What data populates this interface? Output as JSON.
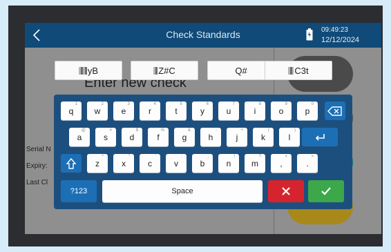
{
  "header": {
    "title": "Check Standards",
    "time": "09:49:23",
    "date": "12/12/2024"
  },
  "page": {
    "heading": "Enter new check",
    "labels": [
      "Serial N",
      "Expiry:",
      "Last Cl"
    ]
  },
  "codes": [
    "yB",
    "Z#C",
    "Q#",
    "C3t"
  ],
  "keyboard": {
    "row1": [
      {
        "k": "q",
        "h": "1"
      },
      {
        "k": "w",
        "h": "2"
      },
      {
        "k": "e",
        "h": "3"
      },
      {
        "k": "r",
        "h": "4"
      },
      {
        "k": "t",
        "h": "5"
      },
      {
        "k": "y",
        "h": "6"
      },
      {
        "k": "u",
        "h": "7"
      },
      {
        "k": "i",
        "h": "8"
      },
      {
        "k": "o",
        "h": "9"
      },
      {
        "k": "p",
        "h": "0"
      }
    ],
    "row2": [
      {
        "k": "a",
        "h": "@"
      },
      {
        "k": "s",
        "h": "#"
      },
      {
        "k": "d",
        "h": "$"
      },
      {
        "k": "f",
        "h": "%"
      },
      {
        "k": "g",
        "h": "&"
      },
      {
        "k": "h",
        "h": "-"
      },
      {
        "k": "j",
        "h": "+"
      },
      {
        "k": "k",
        "h": "("
      },
      {
        "k": "l",
        "h": ")"
      }
    ],
    "row3": [
      {
        "k": "z",
        "h": "*"
      },
      {
        "k": "x",
        "h": "\""
      },
      {
        "k": "c",
        "h": "'"
      },
      {
        "k": "v",
        "h": ":"
      },
      {
        "k": "b",
        "h": ";"
      },
      {
        "k": "n",
        "h": "!"
      },
      {
        "k": "m",
        "h": "?"
      },
      {
        "k": ",",
        "h": "<"
      },
      {
        "k": ".",
        "h": ">"
      }
    ],
    "numbers_label": "?123",
    "space_label": "Space"
  },
  "colors": {
    "accent": "#0f4a78",
    "cancel": "#d6242e",
    "confirm": "#3ca84a"
  }
}
